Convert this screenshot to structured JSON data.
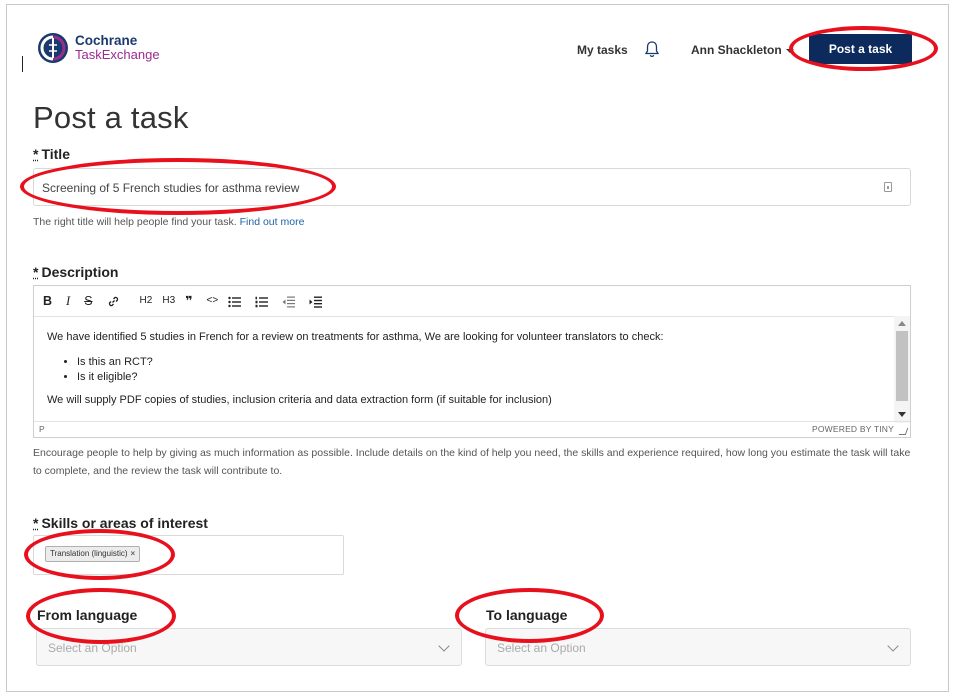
{
  "header": {
    "logo_line1": "Cochrane",
    "logo_line2": "TaskExchange",
    "my_tasks": "My tasks",
    "user_name": "Ann Shackleton",
    "post_task_button": "Post a task",
    "bell_icon": "bell-icon"
  },
  "page_title": "Post a task",
  "title_field": {
    "required_mark": "*",
    "label": "Title",
    "value": "Screening of 5 French studies for asthma review",
    "help_text": "The right title will help people find your task.",
    "help_link": "Find out more"
  },
  "description": {
    "required_mark": "*",
    "label": "Description",
    "toolbar": [
      "B",
      "I",
      "S",
      "link",
      "H2",
      "H3",
      "❞",
      "<>",
      "bullet-list",
      "numbered-list",
      "outdent",
      "indent"
    ],
    "intro": "We have identified 5 studies in French for a review on treatments for asthma, We are looking for volunteer translators to check:",
    "bullets": [
      "Is this an RCT?",
      "Is it eligible?"
    ],
    "outro": "We will supply PDF copies of studies, inclusion criteria and data extraction form (if suitable for inclusion)",
    "status_path": "P",
    "powered_by": "POWERED BY TINY",
    "help_text": "Encourage people to help by giving as much information as possible. Include details on the kind of help you need, the skills and experience required, how long you estimate the task will take to complete, and the review the task will contribute to."
  },
  "skills": {
    "required_mark": "*",
    "label": "Skills or areas of interest",
    "chips": [
      "Translation (linguistic)"
    ],
    "remove_glyph": "×"
  },
  "from_language": {
    "label": "From language",
    "placeholder": "Select an Option"
  },
  "to_language": {
    "label": "To language",
    "placeholder": "Select an Option"
  },
  "colors": {
    "primary_button": "#0c2a5b",
    "annotation_red": "#e8101c",
    "logo_blue": "#1a3a6e",
    "logo_purple": "#9b2b8f",
    "link": "#1e63a8"
  }
}
